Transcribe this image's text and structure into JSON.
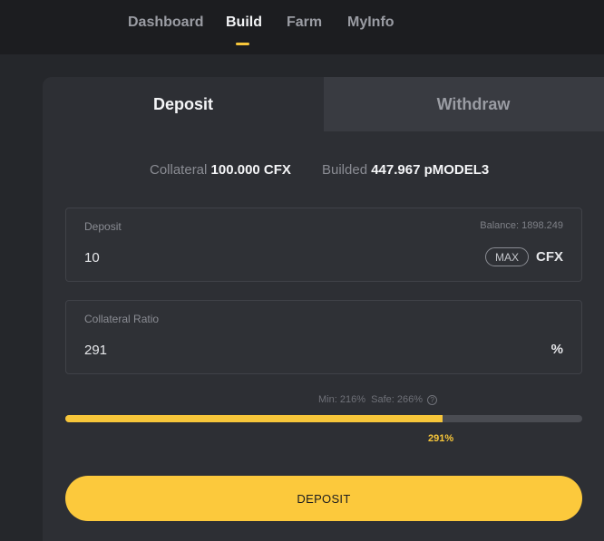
{
  "nav": {
    "items": [
      {
        "label": "Dashboard",
        "active": false
      },
      {
        "label": "Build",
        "active": true
      },
      {
        "label": "Farm",
        "active": false
      },
      {
        "label": "MyInfo",
        "active": false
      }
    ],
    "accent_color": "#f7c63a"
  },
  "tabs": {
    "deposit": "Deposit",
    "withdraw": "Withdraw",
    "active": "deposit"
  },
  "summary": {
    "collateral_label": "Collateral",
    "collateral_value": "100.000 CFX",
    "builded_label": "Builded",
    "builded_value": "447.967 pMODEL3"
  },
  "deposit_field": {
    "label": "Deposit",
    "balance": "Balance: 1898.249",
    "value": "10",
    "max_label": "MAX",
    "unit": "CFX"
  },
  "ratio_field": {
    "label": "Collateral Ratio",
    "value": "291",
    "unit": "%"
  },
  "ratio_bar": {
    "min_label": "Min: 216%",
    "safe_label": "Safe: 266%",
    "help_glyph": "?",
    "current_label": "291%",
    "fill_fraction": 0.73
  },
  "action": {
    "label": "DEPOSIT"
  }
}
